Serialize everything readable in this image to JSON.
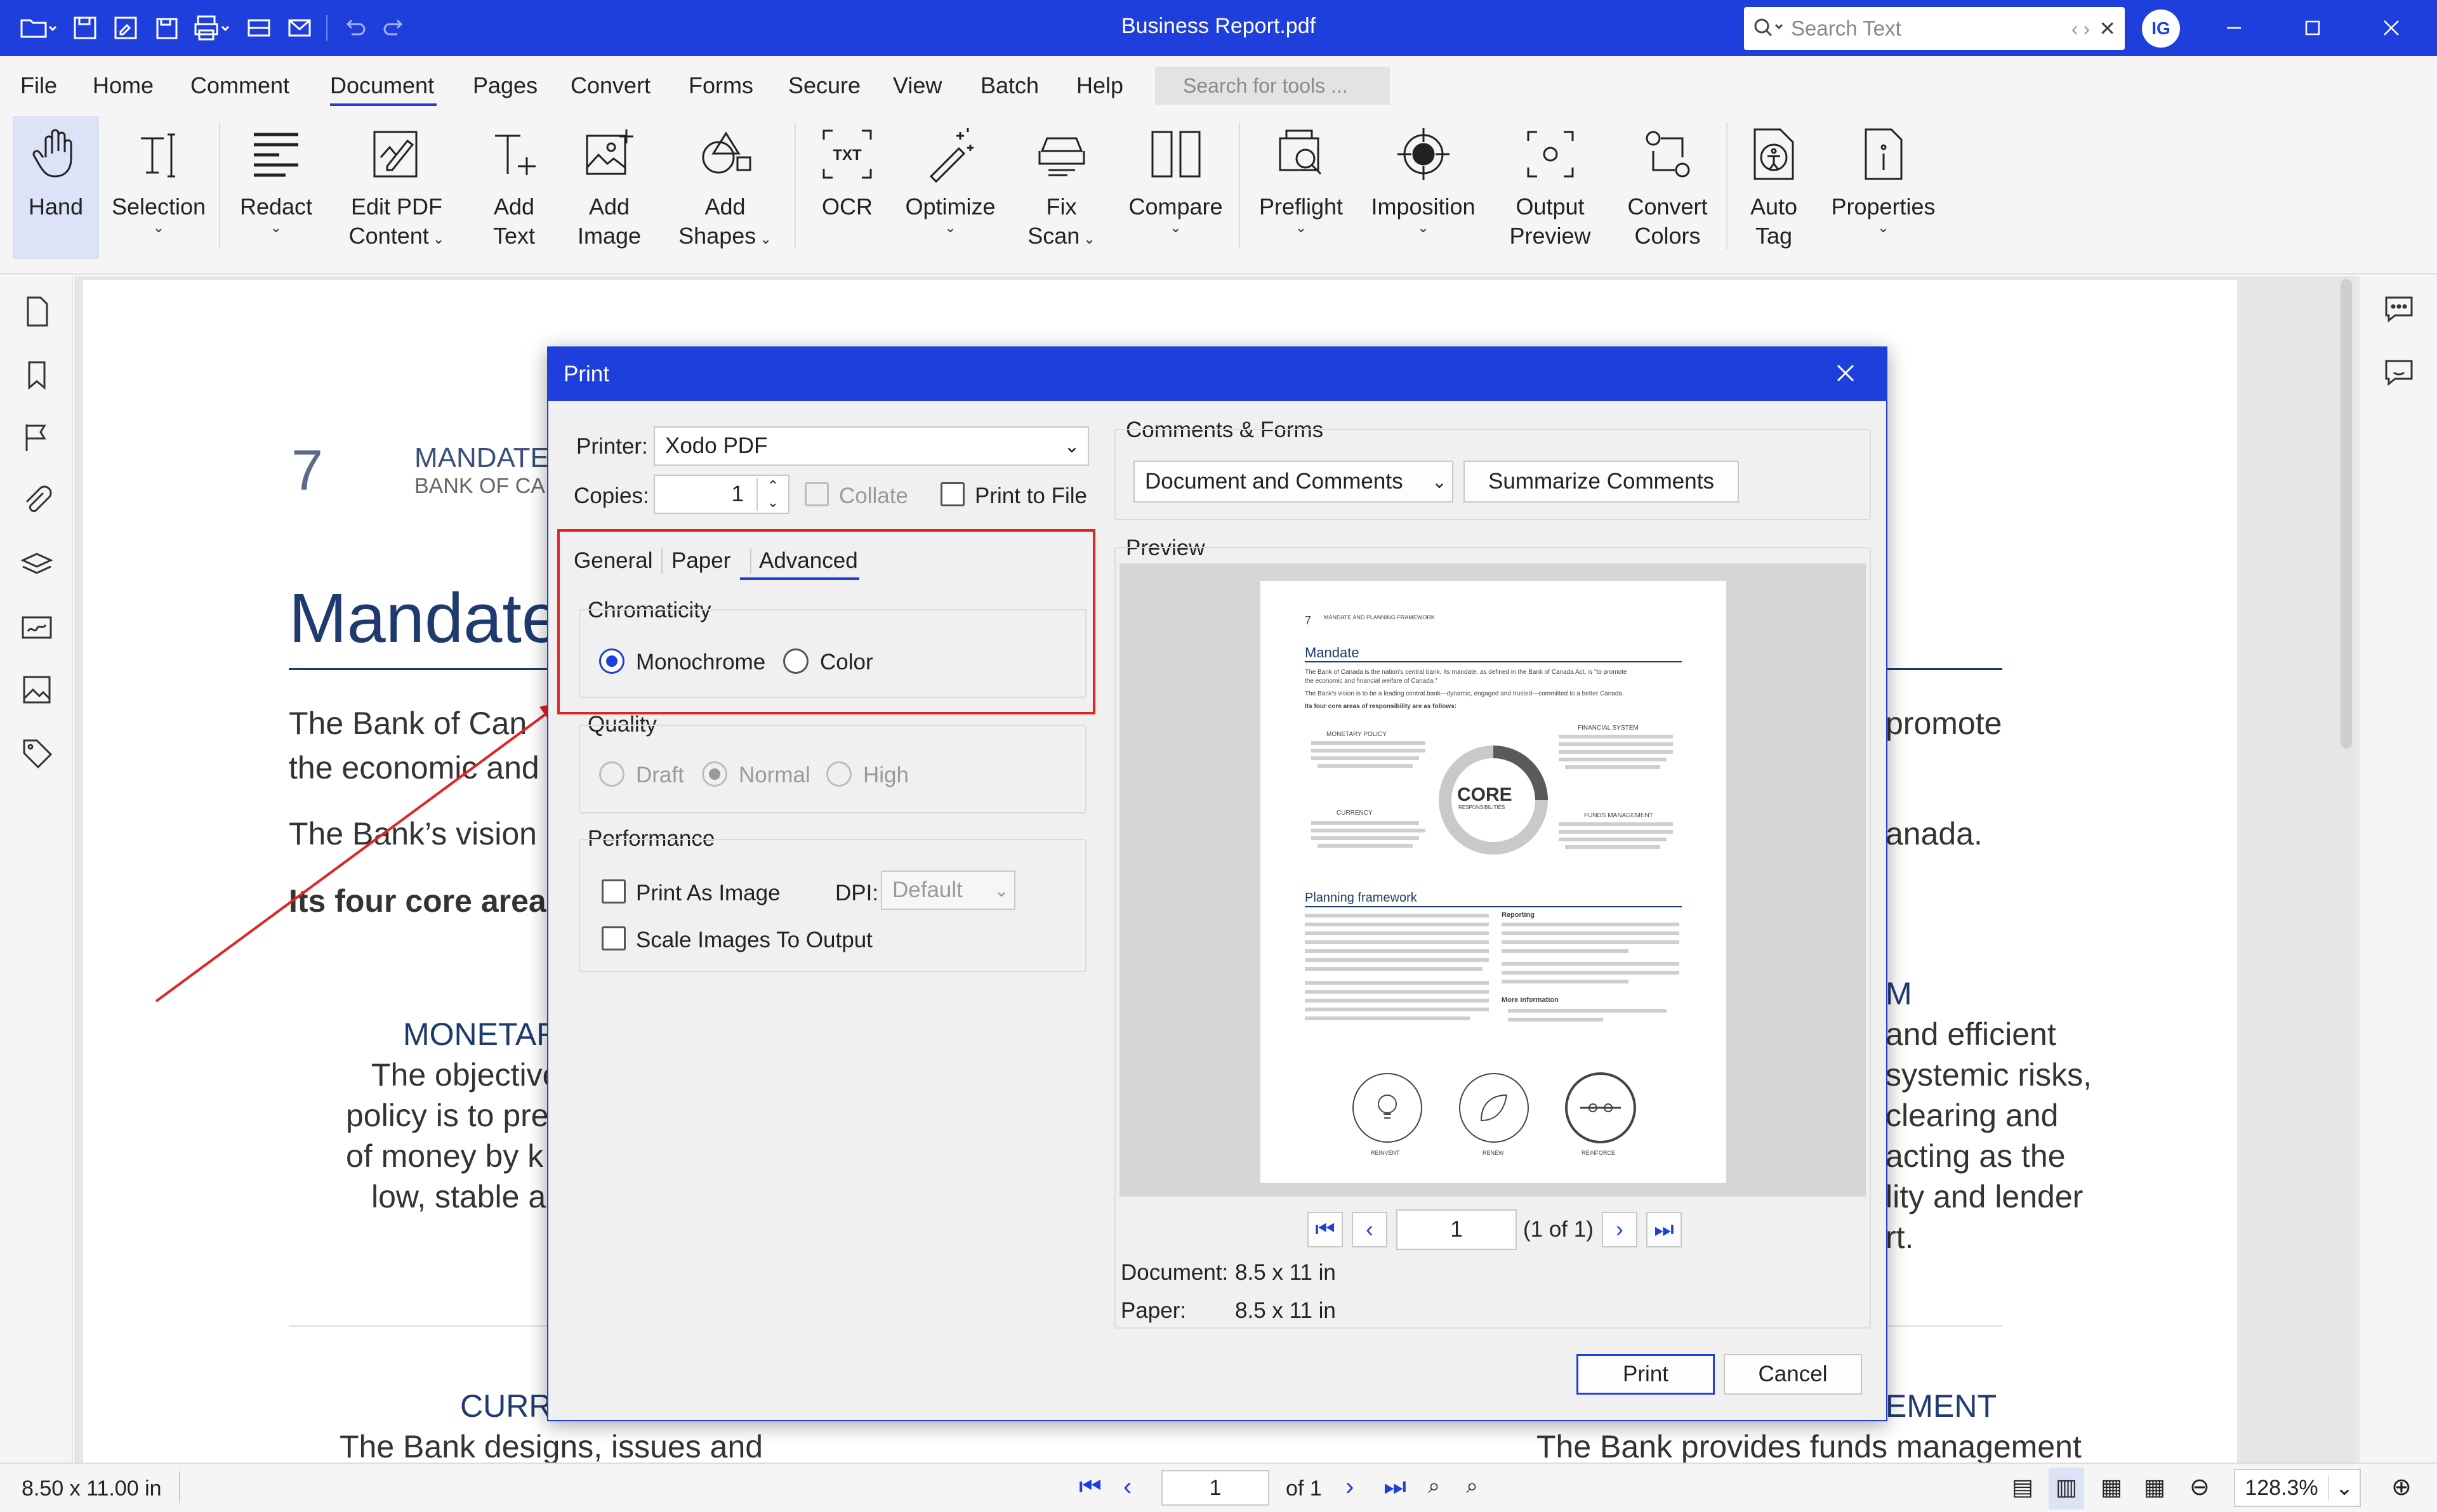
{
  "window": {
    "title": "Business Report.pdf",
    "search_placeholder": "Search Text",
    "avatar_initials": "IG"
  },
  "menu": {
    "items": [
      "File",
      "Home",
      "Comment",
      "Document",
      "Pages",
      "Convert",
      "Forms",
      "Secure",
      "View",
      "Batch",
      "Help"
    ],
    "active": "Document",
    "tool_search_placeholder": "Search for tools ..."
  },
  "ribbon": {
    "hand": "Hand",
    "selection": "Selection",
    "redact": "Redact",
    "edit_pdf_1": "Edit PDF",
    "edit_pdf_2": "Content",
    "add_text_1": "Add",
    "add_text_2": "Text",
    "add_image_1": "Add",
    "add_image_2": "Image",
    "add_shapes_1": "Add",
    "add_shapes_2": "Shapes",
    "ocr": "OCR",
    "optimize": "Optimize",
    "fix_scan_1": "Fix",
    "fix_scan_2": "Scan",
    "compare": "Compare",
    "preflight": "Preflight",
    "imposition": "Imposition",
    "output_preview_1": "Output",
    "output_preview_2": "Preview",
    "convert_colors_1": "Convert",
    "convert_colors_2": "Colors",
    "auto_tag_1": "Auto",
    "auto_tag_2": "Tag",
    "properties": "Properties"
  },
  "document": {
    "page_number": "7",
    "header_1": "MANDATE",
    "header_2": "BANK OF CA",
    "heading": "Mandate",
    "p1a": "The Bank of Can",
    "p1b": "the economic and",
    "p1c": "promote",
    "p2a": "The Bank’s vision",
    "p2b": "anada.",
    "p3": "Its four core area",
    "monetary_title": "MONETAF",
    "monetary_1": "The objective",
    "monetary_2": "policy is to pre",
    "monetary_3": "of money by k",
    "monetary_4": "low, stable ar",
    "financial_title": "M",
    "financial_1": "and efficient",
    "financial_2": "systemic risks,",
    "financial_3": "clearing and",
    "financial_4": "acting as the",
    "financial_5": "lity and lender",
    "financial_6": "rt.",
    "currency_title": "CURR",
    "currency_1": "The Bank designs, issues and",
    "funds_title": "EMENT",
    "funds_1": "The Bank provides funds management"
  },
  "status": {
    "page_size": "8.50 x 11.00 in",
    "page_current": "1",
    "page_of": "of 1",
    "zoom": "128.3%"
  },
  "dialog": {
    "title": "Print",
    "printer_label": "Printer:",
    "printer_value": "Xodo PDF",
    "copies_label": "Copies:",
    "copies_value": "1",
    "collate": "Collate",
    "print_to_file": "Print to File",
    "tabs": [
      "General",
      "Paper",
      "Advanced"
    ],
    "active_tab": "Advanced",
    "chromaticity": "Chromaticity",
    "monochrome": "Monochrome",
    "color": "Color",
    "quality": "Quality",
    "draft": "Draft",
    "normal": "Normal",
    "high": "High",
    "performance": "Performance",
    "print_as_image": "Print As Image",
    "dpi_label": "DPI:",
    "dpi_value": "Default",
    "scale_images": "Scale Images To Output",
    "comments_forms": "Comments & Forms",
    "comments_value": "Document and Comments",
    "summarize": "Summarize Comments",
    "preview": "Preview",
    "preview_page": "1",
    "preview_of": "(1 of 1)",
    "document_label": "Document:",
    "document_size": "8.5 x 11 in",
    "paper_label": "Paper:",
    "paper_size": "8.5 x 11 in",
    "print_button": "Print",
    "cancel_button": "Cancel"
  },
  "preview_thumb": {
    "page_no": "7",
    "header": "MANDATE AND PLANNING FRAMEWORK",
    "mandate": "Mandate",
    "line1": "The Bank of Canada is the nation's central bank. Its mandate, as defined in the Bank of Canada Act, is \"to promote",
    "line2": "the economic and financial welfare of Canada.\"",
    "line3": "The Bank's vision is to be a leading central bank—dynamic, engaged and trusted—committed to a better Canada.",
    "line4": "Its four core areas of responsibility are as follows:",
    "monetary": "MONETARY POLICY",
    "financial": "FINANCIAL SYSTEM",
    "currency": "CURRENCY",
    "funds": "FUNDS MANAGEMENT",
    "core": "CORE",
    "resp": "RESPONSIBILITIES",
    "planning": "Planning framework",
    "reporting": "Reporting",
    "more_info": "More information",
    "reinvent": "REINVENT",
    "renew": "RENEW",
    "reinforce": "REINFORCE"
  },
  "colors": {
    "brand_blue": "#1f3fdd",
    "heading_navy": "#1f3a6e",
    "annotation_red": "#e02424"
  }
}
